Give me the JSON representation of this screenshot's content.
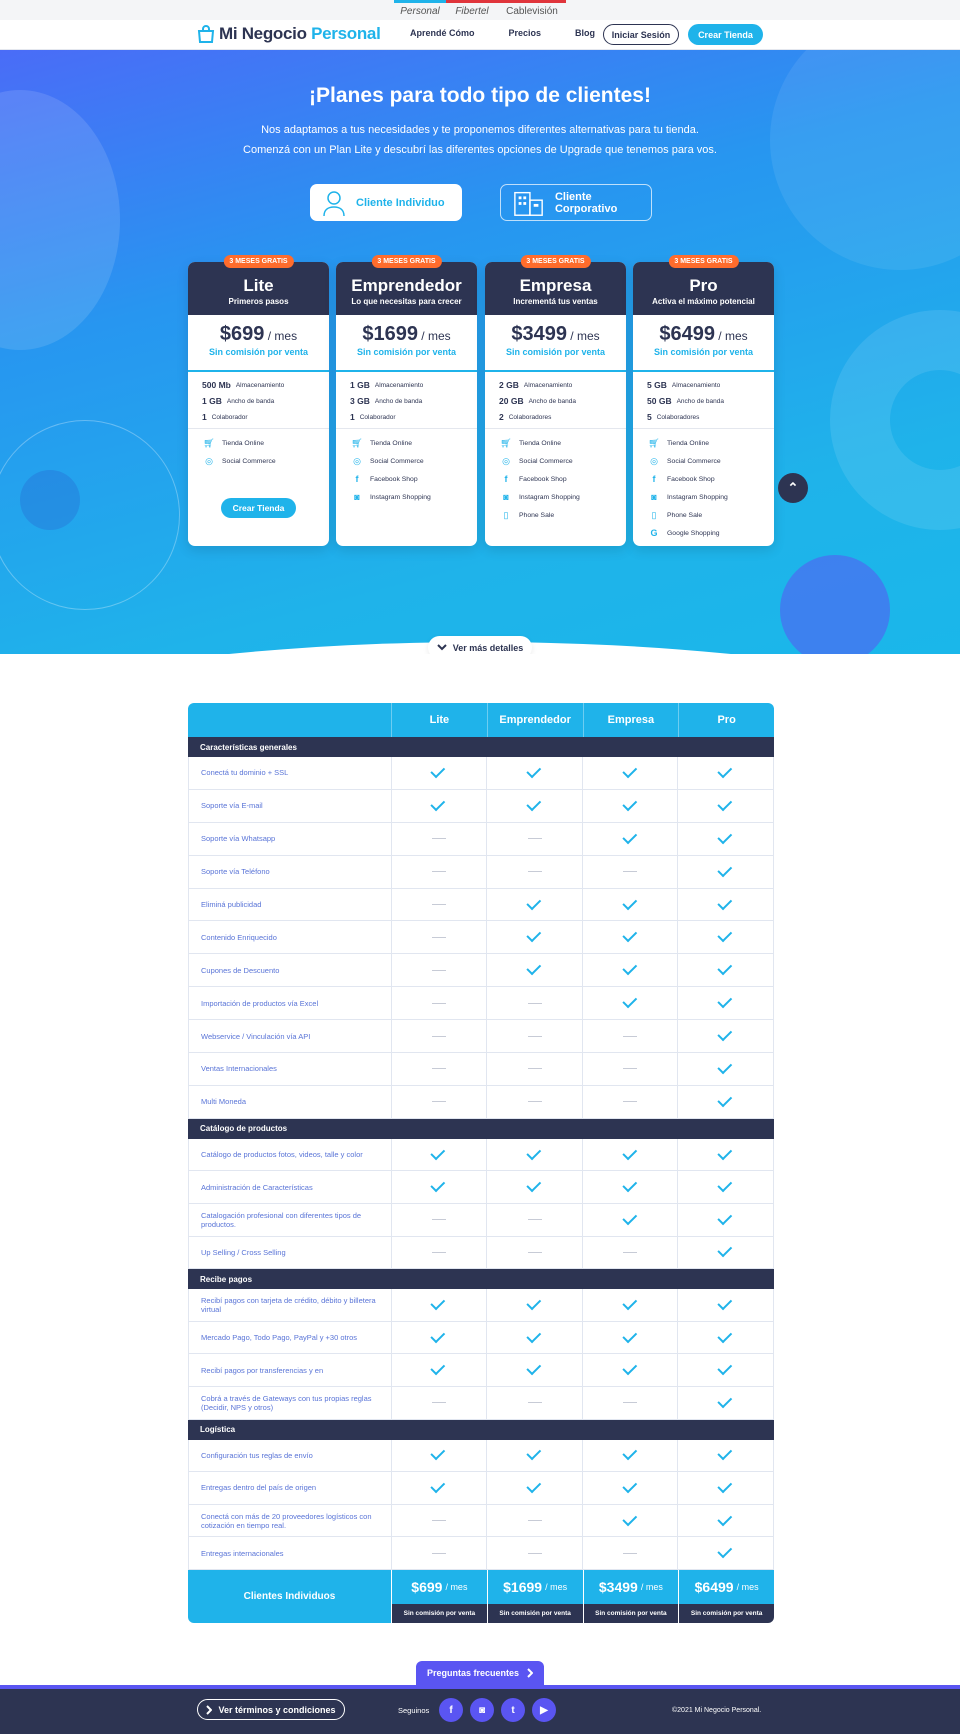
{
  "topbar": {
    "brands": [
      "Personal",
      "Fibertel",
      "Cablevisión"
    ]
  },
  "nav": {
    "logo_a": "Mi Negocio ",
    "logo_b": "Personal",
    "links": [
      "Aprendé Cómo",
      "Precios",
      "Blog"
    ],
    "login": "Iniciar Sesión",
    "create": "Crear Tienda"
  },
  "hero": {
    "title": "¡Planes para todo tipo de clientes!",
    "sub1": "Nos adaptamos a tus necesidades y te proponemos diferentes alternativas para tu tienda.",
    "sub2": "Comenzá con un Plan Lite y descubrí las diferentes opciones de Upgrade que tenemos para vos.",
    "client_individual": "Cliente Individuo",
    "client_corporate": "Cliente Corporativo",
    "more_details": "Ver más detalles"
  },
  "plans": [
    {
      "badge": "3 MESES GRATIS",
      "name": "Lite",
      "tagline": "Primeros pasos",
      "price": "$699",
      "per": " / mes",
      "no_commission": "Sin comisión por venta",
      "specs": [
        [
          "500",
          "Mb",
          "Almacenamiento"
        ],
        [
          "1",
          "GB",
          "Ancho de banda"
        ],
        [
          "1",
          "",
          "Colaborador"
        ]
      ],
      "features": [
        "Tienda Online",
        "Social Commerce"
      ],
      "button": "Crear Tienda"
    },
    {
      "badge": "3 MESES GRATIS",
      "name": "Emprendedor",
      "tagline": "Lo que necesitas para crecer",
      "price": "$1699",
      "per": " / mes",
      "no_commission": "Sin comisión por venta",
      "specs": [
        [
          "1",
          "GB",
          "Almacenamiento"
        ],
        [
          "3",
          "GB",
          "Ancho de banda"
        ],
        [
          "1",
          "",
          "Colaborador"
        ]
      ],
      "features": [
        "Tienda Online",
        "Social Commerce",
        "Facebook Shop",
        "Instagram Shopping"
      ]
    },
    {
      "badge": "3 MESES GRATIS",
      "name": "Empresa",
      "tagline": "Incrementá tus ventas",
      "price": "$3499",
      "per": " / mes",
      "no_commission": "Sin comisión por venta",
      "specs": [
        [
          "2",
          "GB",
          "Almacenamiento"
        ],
        [
          "20",
          "GB",
          "Ancho de banda"
        ],
        [
          "2",
          "",
          "Colaboradores"
        ]
      ],
      "features": [
        "Tienda Online",
        "Social Commerce",
        "Facebook Shop",
        "Instagram Shopping",
        "Phone Sale"
      ]
    },
    {
      "badge": "3 MESES GRATIS",
      "name": "Pro",
      "tagline": "Activa el máximo potencial",
      "price": "$6499",
      "per": " / mes",
      "no_commission": "Sin comisión por venta",
      "specs": [
        [
          "5",
          "GB",
          "Almacenamiento"
        ],
        [
          "50",
          "GB",
          "Ancho de banda"
        ],
        [
          "5",
          "",
          "Colaboradores"
        ]
      ],
      "features": [
        "Tienda Online",
        "Social Commerce",
        "Facebook Shop",
        "Instagram Shopping",
        "Phone Sale",
        "Google Shopping"
      ]
    }
  ],
  "table": {
    "columns": [
      "Lite",
      "Emprendedor",
      "Empresa",
      "Pro"
    ],
    "sections": [
      {
        "title": "Características generales",
        "rows": [
          {
            "label": "Conectá tu dominio + SSL",
            "v": [
              1,
              1,
              1,
              1
            ]
          },
          {
            "label": "Soporte vía E-mail",
            "v": [
              1,
              1,
              1,
              1
            ]
          },
          {
            "label": "Soporte vía Whatsapp",
            "v": [
              0,
              0,
              1,
              1
            ]
          },
          {
            "label": "Soporte vía Teléfono",
            "v": [
              0,
              0,
              0,
              1
            ]
          },
          {
            "label": "Eliminá publicidad",
            "v": [
              0,
              1,
              1,
              1
            ]
          },
          {
            "label": "Contenido Enriquecido",
            "v": [
              0,
              1,
              1,
              1
            ]
          },
          {
            "label": "Cupones de Descuento",
            "v": [
              0,
              1,
              1,
              1
            ]
          },
          {
            "label": "Importación de productos vía Excel",
            "v": [
              0,
              0,
              1,
              1
            ]
          },
          {
            "label": "Webservice / Vinculación vía API",
            "v": [
              0,
              0,
              0,
              1
            ]
          },
          {
            "label": "Ventas Internacionales",
            "v": [
              0,
              0,
              0,
              1
            ]
          },
          {
            "label": "Multi Moneda",
            "v": [
              0,
              0,
              0,
              1
            ]
          }
        ]
      },
      {
        "title": "Catálogo de productos",
        "rows": [
          {
            "label": "Catálogo de productos fotos, videos, talle y color",
            "v": [
              1,
              1,
              1,
              1
            ]
          },
          {
            "label": "Administración de Características",
            "v": [
              1,
              1,
              1,
              1
            ]
          },
          {
            "label": "Catalogación profesional con diferentes tipos de productos.",
            "v": [
              0,
              0,
              1,
              1
            ]
          },
          {
            "label": "Up Selling / Cross Selling",
            "v": [
              0,
              0,
              0,
              1
            ]
          }
        ]
      },
      {
        "title": "Recibe pagos",
        "rows": [
          {
            "label": "Recibí pagos con tarjeta de crédito, débito y billetera virtual",
            "v": [
              1,
              1,
              1,
              1
            ]
          },
          {
            "label": "Mercado Pago, Todo Pago, PayPal y +30 otros",
            "v": [
              1,
              1,
              1,
              1
            ]
          },
          {
            "label": "Recibí pagos por transferencias y en",
            "v": [
              1,
              1,
              1,
              1
            ]
          },
          {
            "label": "Cobrá a través de Gateways con tus propias reglas (Decidir, NPS y otros)",
            "v": [
              0,
              0,
              0,
              1
            ]
          }
        ]
      },
      {
        "title": "Logística",
        "rows": [
          {
            "label": "Configuración tus reglas de envío",
            "v": [
              1,
              1,
              1,
              1
            ]
          },
          {
            "label": "Entregas dentro del país de origen",
            "v": [
              1,
              1,
              1,
              1
            ]
          },
          {
            "label": "Conectá con más de 20 proveedores logísticos con cotización en tiempo real.",
            "v": [
              0,
              0,
              1,
              1
            ]
          },
          {
            "label": "Entregas internacionales",
            "v": [
              0,
              0,
              0,
              1
            ]
          }
        ]
      }
    ],
    "footer_label": "Clientes Individuos",
    "footer_prices": [
      "$699",
      "$1699",
      "$3499",
      "$6499"
    ],
    "footer_per": "/ mes",
    "footer_note": "Sin comisión por venta"
  },
  "faq": "Preguntas frecuentes",
  "footer": {
    "terms": "Ver términos y condiciones",
    "follow": "Seguinos",
    "copyright": "©2021 Mi Negocio Personal."
  },
  "colors": {
    "primary": "#1fb3ea",
    "dark": "#2d3452",
    "accent": "#5a55f2",
    "badge": "#ff6c2c"
  }
}
